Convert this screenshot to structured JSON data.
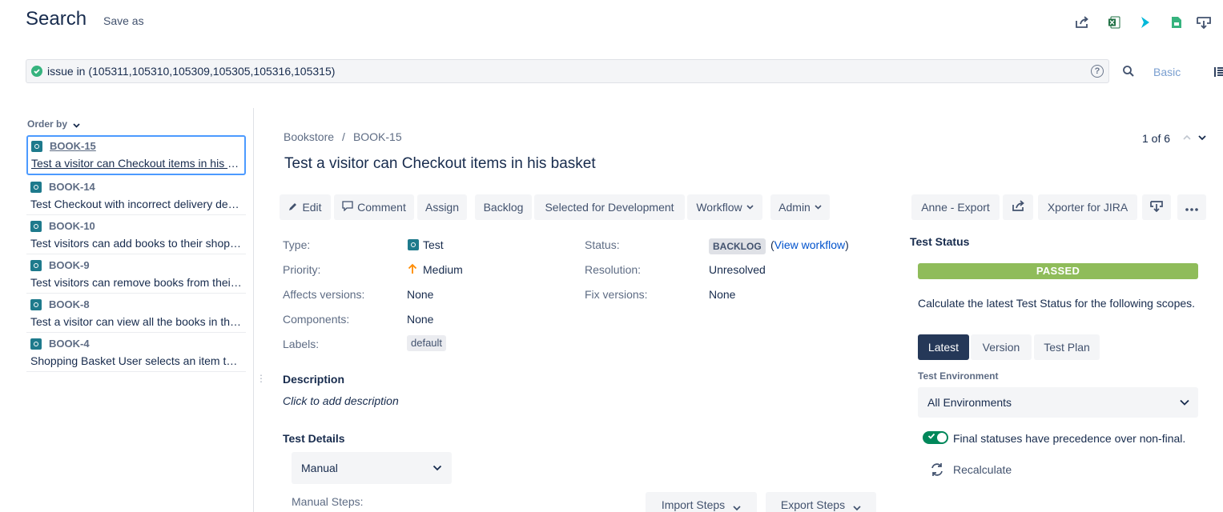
{
  "header": {
    "title": "Search",
    "save_as": "Save as",
    "icons": [
      "share-icon",
      "excel-icon",
      "xray-icon",
      "csv-icon",
      "download-icon"
    ]
  },
  "search": {
    "query": "issue in (105311,105310,105309,105305,105316,105315)",
    "help": "?",
    "mode_label": "Basic"
  },
  "list": {
    "order_by": "Order by",
    "items": [
      {
        "key": "BOOK-15",
        "summary": "Test a visitor can Checkout items in his basket"
      },
      {
        "key": "BOOK-14",
        "summary": "Test Checkout with incorrect delivery details"
      },
      {
        "key": "BOOK-10",
        "summary": "Test visitors can add books to their shopping basket"
      },
      {
        "key": "BOOK-9",
        "summary": "Test visitors can remove books from their basket"
      },
      {
        "key": "BOOK-8",
        "summary": "Test a visitor can view all the books in the store"
      },
      {
        "key": "BOOK-4",
        "summary": "Shopping Basket User selects an item to purchase"
      }
    ]
  },
  "issue": {
    "project": "Bookstore",
    "separator": "/",
    "key": "BOOK-15",
    "pager": "1 of 6",
    "title": "Test a visitor can Checkout items in his basket",
    "toolbar": {
      "edit": "Edit",
      "comment": "Comment",
      "assign": "Assign",
      "backlog": "Backlog",
      "selected": "Selected for Development",
      "workflow": "Workflow",
      "admin": "Admin",
      "anne_export": "Anne - Export",
      "xporter": "Xporter for JIRA"
    },
    "fields": {
      "type_label": "Type:",
      "type_value": "Test",
      "priority_label": "Priority:",
      "priority_value": "Medium",
      "affects_label": "Affects versions:",
      "affects_value": "None",
      "components_label": "Components:",
      "components_value": "None",
      "labels_label": "Labels:",
      "labels_value": "default",
      "status_label": "Status:",
      "status_value": "BACKLOG",
      "view_workflow": "View workflow",
      "resolution_label": "Resolution:",
      "resolution_value": "Unresolved",
      "fix_label": "Fix versions:",
      "fix_value": "None"
    },
    "description": {
      "heading": "Description",
      "placeholder": "Click to add description"
    },
    "test_details": {
      "heading": "Test Details",
      "type_selected": "Manual",
      "steps_label": "Manual Steps:",
      "import_steps": "Import Steps",
      "export_steps": "Export Steps"
    }
  },
  "test_status": {
    "heading": "Test Status",
    "status": "PASSED",
    "status_color": "#8fbc5a",
    "calc_text": "Calculate the latest Test Status for the following scopes.",
    "scopes": [
      "Latest",
      "Version",
      "Test Plan"
    ],
    "env_label": "Test Environment",
    "env_value": "All Environments",
    "toggle_text": "Final statuses have precedence over non-final.",
    "toggle_on": true,
    "recalculate": "Recalculate"
  }
}
